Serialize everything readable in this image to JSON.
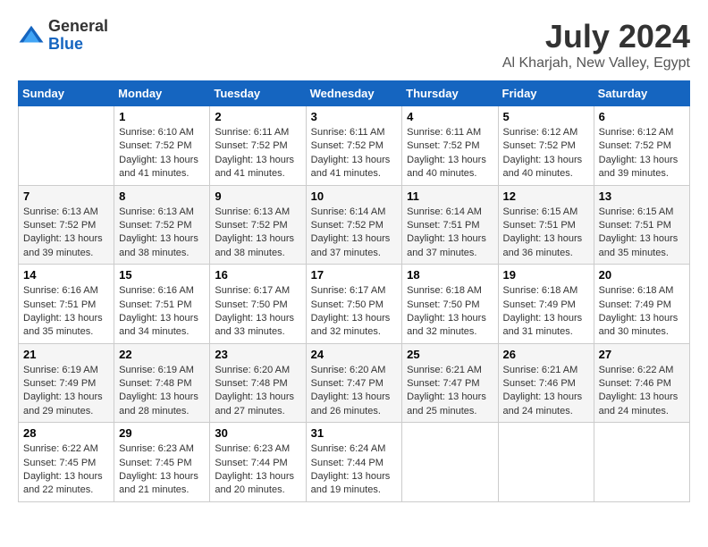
{
  "logo": {
    "general": "General",
    "blue": "Blue"
  },
  "title": "July 2024",
  "location": "Al Kharjah, New Valley, Egypt",
  "days_of_week": [
    "Sunday",
    "Monday",
    "Tuesday",
    "Wednesday",
    "Thursday",
    "Friday",
    "Saturday"
  ],
  "weeks": [
    [
      {
        "day": "",
        "sunrise": "",
        "sunset": "",
        "daylight": ""
      },
      {
        "day": "1",
        "sunrise": "Sunrise: 6:10 AM",
        "sunset": "Sunset: 7:52 PM",
        "daylight": "Daylight: 13 hours and 41 minutes."
      },
      {
        "day": "2",
        "sunrise": "Sunrise: 6:11 AM",
        "sunset": "Sunset: 7:52 PM",
        "daylight": "Daylight: 13 hours and 41 minutes."
      },
      {
        "day": "3",
        "sunrise": "Sunrise: 6:11 AM",
        "sunset": "Sunset: 7:52 PM",
        "daylight": "Daylight: 13 hours and 41 minutes."
      },
      {
        "day": "4",
        "sunrise": "Sunrise: 6:11 AM",
        "sunset": "Sunset: 7:52 PM",
        "daylight": "Daylight: 13 hours and 40 minutes."
      },
      {
        "day": "5",
        "sunrise": "Sunrise: 6:12 AM",
        "sunset": "Sunset: 7:52 PM",
        "daylight": "Daylight: 13 hours and 40 minutes."
      },
      {
        "day": "6",
        "sunrise": "Sunrise: 6:12 AM",
        "sunset": "Sunset: 7:52 PM",
        "daylight": "Daylight: 13 hours and 39 minutes."
      }
    ],
    [
      {
        "day": "7",
        "sunrise": "Sunrise: 6:13 AM",
        "sunset": "Sunset: 7:52 PM",
        "daylight": "Daylight: 13 hours and 39 minutes."
      },
      {
        "day": "8",
        "sunrise": "Sunrise: 6:13 AM",
        "sunset": "Sunset: 7:52 PM",
        "daylight": "Daylight: 13 hours and 38 minutes."
      },
      {
        "day": "9",
        "sunrise": "Sunrise: 6:13 AM",
        "sunset": "Sunset: 7:52 PM",
        "daylight": "Daylight: 13 hours and 38 minutes."
      },
      {
        "day": "10",
        "sunrise": "Sunrise: 6:14 AM",
        "sunset": "Sunset: 7:52 PM",
        "daylight": "Daylight: 13 hours and 37 minutes."
      },
      {
        "day": "11",
        "sunrise": "Sunrise: 6:14 AM",
        "sunset": "Sunset: 7:51 PM",
        "daylight": "Daylight: 13 hours and 37 minutes."
      },
      {
        "day": "12",
        "sunrise": "Sunrise: 6:15 AM",
        "sunset": "Sunset: 7:51 PM",
        "daylight": "Daylight: 13 hours and 36 minutes."
      },
      {
        "day": "13",
        "sunrise": "Sunrise: 6:15 AM",
        "sunset": "Sunset: 7:51 PM",
        "daylight": "Daylight: 13 hours and 35 minutes."
      }
    ],
    [
      {
        "day": "14",
        "sunrise": "Sunrise: 6:16 AM",
        "sunset": "Sunset: 7:51 PM",
        "daylight": "Daylight: 13 hours and 35 minutes."
      },
      {
        "day": "15",
        "sunrise": "Sunrise: 6:16 AM",
        "sunset": "Sunset: 7:51 PM",
        "daylight": "Daylight: 13 hours and 34 minutes."
      },
      {
        "day": "16",
        "sunrise": "Sunrise: 6:17 AM",
        "sunset": "Sunset: 7:50 PM",
        "daylight": "Daylight: 13 hours and 33 minutes."
      },
      {
        "day": "17",
        "sunrise": "Sunrise: 6:17 AM",
        "sunset": "Sunset: 7:50 PM",
        "daylight": "Daylight: 13 hours and 32 minutes."
      },
      {
        "day": "18",
        "sunrise": "Sunrise: 6:18 AM",
        "sunset": "Sunset: 7:50 PM",
        "daylight": "Daylight: 13 hours and 32 minutes."
      },
      {
        "day": "19",
        "sunrise": "Sunrise: 6:18 AM",
        "sunset": "Sunset: 7:49 PM",
        "daylight": "Daylight: 13 hours and 31 minutes."
      },
      {
        "day": "20",
        "sunrise": "Sunrise: 6:18 AM",
        "sunset": "Sunset: 7:49 PM",
        "daylight": "Daylight: 13 hours and 30 minutes."
      }
    ],
    [
      {
        "day": "21",
        "sunrise": "Sunrise: 6:19 AM",
        "sunset": "Sunset: 7:49 PM",
        "daylight": "Daylight: 13 hours and 29 minutes."
      },
      {
        "day": "22",
        "sunrise": "Sunrise: 6:19 AM",
        "sunset": "Sunset: 7:48 PM",
        "daylight": "Daylight: 13 hours and 28 minutes."
      },
      {
        "day": "23",
        "sunrise": "Sunrise: 6:20 AM",
        "sunset": "Sunset: 7:48 PM",
        "daylight": "Daylight: 13 hours and 27 minutes."
      },
      {
        "day": "24",
        "sunrise": "Sunrise: 6:20 AM",
        "sunset": "Sunset: 7:47 PM",
        "daylight": "Daylight: 13 hours and 26 minutes."
      },
      {
        "day": "25",
        "sunrise": "Sunrise: 6:21 AM",
        "sunset": "Sunset: 7:47 PM",
        "daylight": "Daylight: 13 hours and 25 minutes."
      },
      {
        "day": "26",
        "sunrise": "Sunrise: 6:21 AM",
        "sunset": "Sunset: 7:46 PM",
        "daylight": "Daylight: 13 hours and 24 minutes."
      },
      {
        "day": "27",
        "sunrise": "Sunrise: 6:22 AM",
        "sunset": "Sunset: 7:46 PM",
        "daylight": "Daylight: 13 hours and 24 minutes."
      }
    ],
    [
      {
        "day": "28",
        "sunrise": "Sunrise: 6:22 AM",
        "sunset": "Sunset: 7:45 PM",
        "daylight": "Daylight: 13 hours and 22 minutes."
      },
      {
        "day": "29",
        "sunrise": "Sunrise: 6:23 AM",
        "sunset": "Sunset: 7:45 PM",
        "daylight": "Daylight: 13 hours and 21 minutes."
      },
      {
        "day": "30",
        "sunrise": "Sunrise: 6:23 AM",
        "sunset": "Sunset: 7:44 PM",
        "daylight": "Daylight: 13 hours and 20 minutes."
      },
      {
        "day": "31",
        "sunrise": "Sunrise: 6:24 AM",
        "sunset": "Sunset: 7:44 PM",
        "daylight": "Daylight: 13 hours and 19 minutes."
      },
      {
        "day": "",
        "sunrise": "",
        "sunset": "",
        "daylight": ""
      },
      {
        "day": "",
        "sunrise": "",
        "sunset": "",
        "daylight": ""
      },
      {
        "day": "",
        "sunrise": "",
        "sunset": "",
        "daylight": ""
      }
    ]
  ]
}
